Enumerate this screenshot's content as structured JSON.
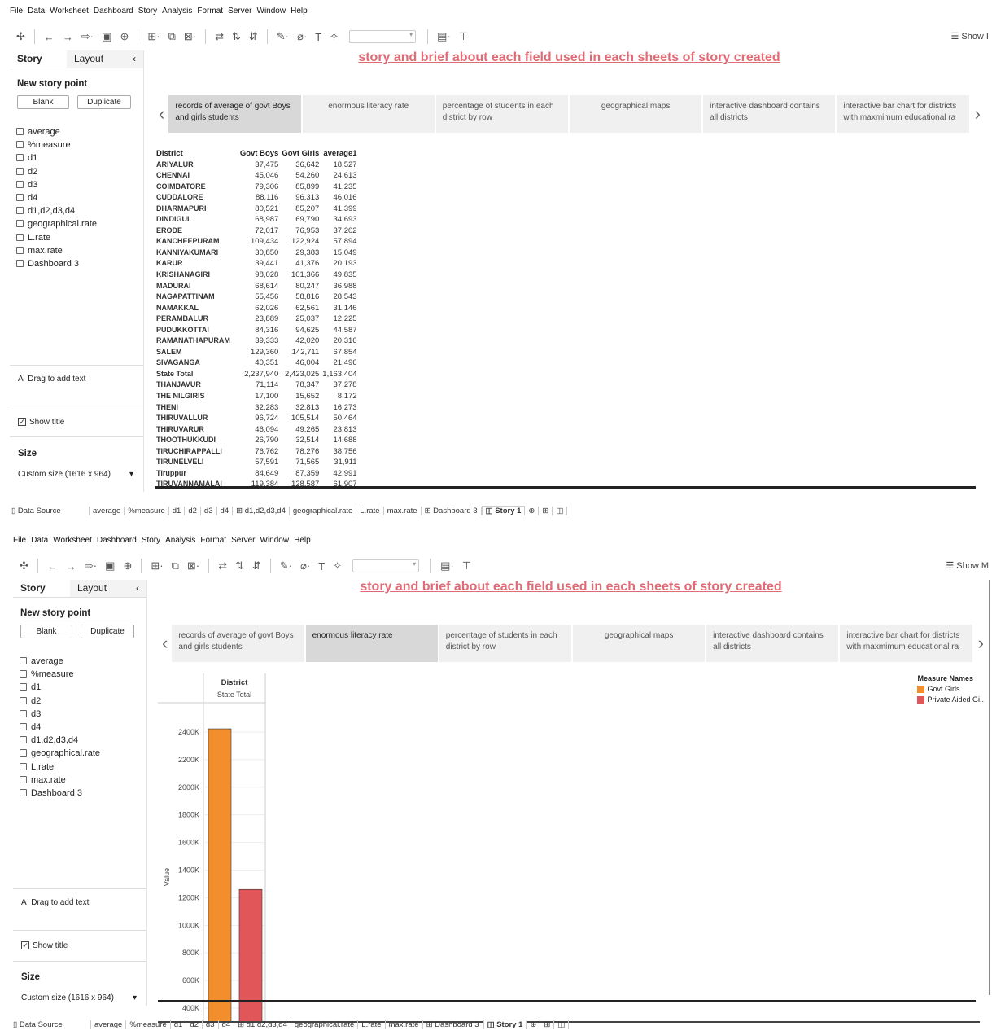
{
  "menu": [
    "File",
    "Data",
    "Worksheet",
    "Dashboard",
    "Story",
    "Analysis",
    "Format",
    "Server",
    "Window",
    "Help"
  ],
  "toolbar": {
    "show_me_1": "Show I",
    "show_me_2": "Show M"
  },
  "sidebar": {
    "tab_story": "Story",
    "tab_layout": "Layout",
    "collapse_glyph": "‹",
    "new_story_point": "New story point",
    "blank": "Blank",
    "duplicate": "Duplicate",
    "sheets": [
      "average",
      "%measure",
      "d1",
      "d2",
      "d3",
      "d4",
      "d1,d2,d3,d4",
      "geographical.rate",
      "L.rate",
      "max.rate",
      "Dashboard 3"
    ],
    "drag_to_add_text": "Drag to add text",
    "drag_glyph": "A",
    "show_title": "Show title",
    "size_label": "Size",
    "custom_size": "Custom size (1616 x 964)"
  },
  "story": {
    "title": "story and brief about each field used in each  sheets of story created",
    "points": [
      "records of average of govt Boys and girls students",
      "enormous literacy rate",
      "percentage of students in each district by row",
      "geographical maps",
      "interactive dashboard contains all districts",
      "interactive bar chart for districts with maxmimum educational ra"
    ]
  },
  "table": {
    "headers": [
      "District",
      "Govt Boys",
      "Govt Girls",
      "average1"
    ],
    "rows": [
      [
        "ARIYALUR",
        "37,475",
        "36,642",
        "18,527"
      ],
      [
        "CHENNAI",
        "45,046",
        "54,260",
        "24,613"
      ],
      [
        "COIMBATORE",
        "79,306",
        "85,899",
        "41,235"
      ],
      [
        "CUDDALORE",
        "88,116",
        "96,313",
        "46,016"
      ],
      [
        "DHARMAPURI",
        "80,521",
        "85,207",
        "41,399"
      ],
      [
        "DINDIGUL",
        "68,987",
        "69,790",
        "34,693"
      ],
      [
        "ERODE",
        "72,017",
        "76,953",
        "37,202"
      ],
      [
        "KANCHEEPURAM",
        "109,434",
        "122,924",
        "57,894"
      ],
      [
        "KANNIYAKUMARI",
        "30,850",
        "29,383",
        "15,049"
      ],
      [
        "KARUR",
        "39,441",
        "41,376",
        "20,193"
      ],
      [
        "KRISHANAGIRI",
        "98,028",
        "101,366",
        "49,835"
      ],
      [
        "MADURAI",
        "68,614",
        "80,247",
        "36,988"
      ],
      [
        "NAGAPATTINAM",
        "55,456",
        "58,816",
        "28,543"
      ],
      [
        "NAMAKKAL",
        "62,026",
        "62,561",
        "31,146"
      ],
      [
        "PERAMBALUR",
        "23,889",
        "25,037",
        "12,225"
      ],
      [
        "PUDUKKOTTAI",
        "84,316",
        "94,625",
        "44,587"
      ],
      [
        "RAMANATHAPURAM",
        "39,333",
        "42,020",
        "20,316"
      ],
      [
        "SALEM",
        "129,360",
        "142,711",
        "67,854"
      ],
      [
        "SIVAGANGA",
        "40,351",
        "46,004",
        "21,496"
      ],
      [
        "State Total",
        "2,237,940",
        "2,423,025",
        "1,163,404"
      ],
      [
        "THANJAVUR",
        "71,114",
        "78,347",
        "37,278"
      ],
      [
        "THE NILGIRIS",
        "17,100",
        "15,652",
        "8,172"
      ],
      [
        "THENI",
        "32,283",
        "32,813",
        "16,273"
      ],
      [
        "THIRUVALLUR",
        "96,724",
        "105,514",
        "50,464"
      ],
      [
        "THIRUVARUR",
        "46,094",
        "49,265",
        "23,813"
      ],
      [
        "THOOTHUKKUDI",
        "26,790",
        "32,514",
        "14,688"
      ],
      [
        "TIRUCHIRAPPALLI",
        "76,762",
        "78,276",
        "38,756"
      ],
      [
        "TIRUNELVELI",
        "57,591",
        "71,565",
        "31,911"
      ],
      [
        "Tiruppur",
        "84,649",
        "87,359",
        "42,991"
      ],
      [
        "TIRUVANNAMALAI",
        "119,384",
        "128,587",
        "61,907"
      ]
    ]
  },
  "tabs": {
    "data_source": "Data Source",
    "sheets_1": [
      "average",
      "%measure",
      "d1",
      "d2",
      "d3",
      "d4",
      "d1,d2,d3,d4",
      "geographical.rate",
      "L.rate",
      "max.rate",
      "Dashboard 3",
      "Story 1"
    ],
    "sheets_2": [
      "average",
      "%measure",
      "d1",
      "d2",
      "d3",
      "d4",
      "d1,d2,d3,d4",
      "geographical.rate",
      "L.rate",
      "max.rate",
      "Dashboard 3",
      "Story 1"
    ]
  },
  "chart_data": {
    "type": "bar",
    "header_title": "District",
    "categories": [
      "State Total"
    ],
    "series": [
      {
        "name": "Govt Girls",
        "values": [
          2423025
        ],
        "color": "#f28e2b"
      },
      {
        "name": "Private Aided Gi..",
        "values": [
          1260000
        ],
        "color": "#e15759"
      }
    ],
    "ylabel": "Value",
    "ylim": [
      300000,
      2500000
    ],
    "yticks": [
      "400K",
      "600K",
      "800K",
      "1000K",
      "1200K",
      "1400K",
      "1600K",
      "1800K",
      "2000K",
      "2200K",
      "2400K"
    ],
    "ytick_values": [
      400000,
      600000,
      800000,
      1000000,
      1200000,
      1400000,
      1600000,
      1800000,
      2000000,
      2200000,
      2400000
    ],
    "legend_title": "Measure Names",
    "legend_placement": "top-right",
    "grid": true
  }
}
